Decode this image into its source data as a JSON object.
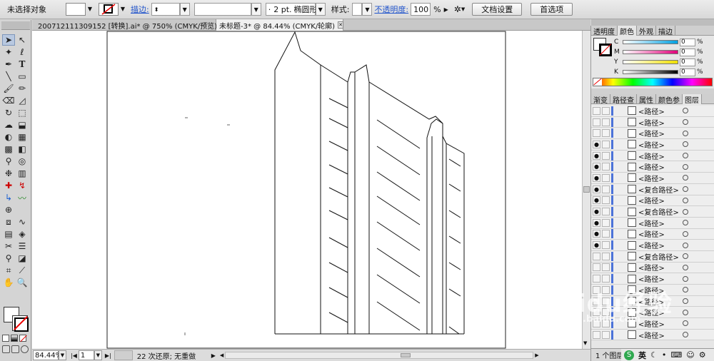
{
  "control_bar": {
    "selection_status": "未选择对象",
    "stroke_label": "描边:",
    "stroke_size": "2 pt.",
    "brush_shape": "椭圆形",
    "style_label": "样式:",
    "opacity_label": "不透明度:",
    "opacity_value": "100",
    "opacity_unit": "%",
    "doc_settings_button": "文档设置",
    "preferences_button": "首选项"
  },
  "tabs": [
    {
      "label": "200712111309152 [转换].ai* @ 750% (CMYK/预览)",
      "active": false
    },
    {
      "label": "未标题-3* @ 84.44% (CMYK/轮廓)",
      "active": true
    }
  ],
  "status_bar": {
    "zoom": "84.44%",
    "artboard_number": "1",
    "undo_info": "22 次还原; 无重做"
  },
  "color_panel": {
    "tabs": [
      "透明度",
      "颜色",
      "外观",
      "描边"
    ],
    "active_tab": "颜色",
    "channels": [
      {
        "name": "C",
        "value": "0",
        "unit": "%"
      },
      {
        "name": "M",
        "value": "0",
        "unit": "%"
      },
      {
        "name": "Y",
        "value": "0",
        "unit": "%"
      },
      {
        "name": "K",
        "value": "0",
        "unit": "%"
      }
    ]
  },
  "layers_panel": {
    "tabs": [
      "渐变",
      "路径查",
      "属性",
      "颜色参",
      "图层"
    ],
    "active_tab": "图层",
    "footer": "1 个图层",
    "items": [
      {
        "name": "<路径>",
        "eye": false
      },
      {
        "name": "<路径>",
        "eye": false
      },
      {
        "name": "<路径>",
        "eye": false
      },
      {
        "name": "<路径>",
        "eye": true
      },
      {
        "name": "<路径>",
        "eye": true
      },
      {
        "name": "<路径>",
        "eye": true
      },
      {
        "name": "<路径>",
        "eye": true
      },
      {
        "name": "<复合路径>",
        "eye": true
      },
      {
        "name": "<路径>",
        "eye": true
      },
      {
        "name": "<复合路径>",
        "eye": true
      },
      {
        "name": "<路径>",
        "eye": true
      },
      {
        "name": "<路径>",
        "eye": true
      },
      {
        "name": "<路径>",
        "eye": true
      },
      {
        "name": "<复合路径>",
        "eye": false
      },
      {
        "name": "<路径>",
        "eye": false
      },
      {
        "name": "<路径>",
        "eye": false
      },
      {
        "name": "<路径>",
        "eye": false
      },
      {
        "name": "<路径>",
        "eye": false
      },
      {
        "name": "<路径>",
        "eye": false
      },
      {
        "name": "<路径>",
        "eye": false
      },
      {
        "name": "<路径>",
        "eye": false
      }
    ]
  },
  "watermark": {
    "brand": "Baidu经验",
    "url": "jingyan.baidu.com"
  },
  "tray": {
    "ime": "英"
  },
  "colors": {
    "accent_blue": "#4c73d9",
    "link_blue": "#2255cc",
    "none_red": "#e00000"
  }
}
